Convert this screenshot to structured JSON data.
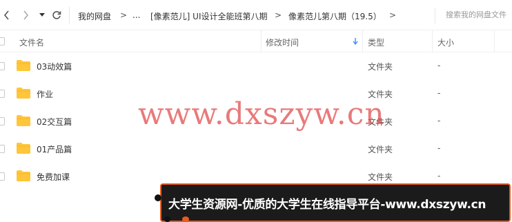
{
  "nav": {
    "back_icon": "chevron-left-icon",
    "forward_icon": "chevron-right-icon",
    "history_icon": "caret-down-icon",
    "refresh_icon": "refresh-icon",
    "breadcrumbs": [
      "我的网盘",
      "...",
      "[像素范儿] UI设计全能班第八期",
      "像素范儿第八期（19.5）"
    ],
    "separator": ">"
  },
  "search": {
    "placeholder": "搜索我的网盘文件"
  },
  "columns": {
    "name": "文件名",
    "modified": "修改时间",
    "type": "类型",
    "size": "大小",
    "sort_icon": "arrow-down-icon"
  },
  "files": [
    {
      "name": "03动效篇",
      "type": "文件夹",
      "size": "-"
    },
    {
      "name": "作业",
      "type": "文件夹",
      "size": "-"
    },
    {
      "name": "02交互篇",
      "type": "文件夹",
      "size": "-"
    },
    {
      "name": "01产品篇",
      "type": "文件夹",
      "size": "-"
    },
    {
      "name": "免费加课",
      "type": "文件夹",
      "size": "-"
    }
  ],
  "watermark": "www.dxszyw.cn",
  "banner": "大学生资源网-优质的大学生在线指导平台-www.dxszyw.cn",
  "colors": {
    "folder": "#FFC63B",
    "watermark": "#E04646",
    "banner_bg": "#1C1B1B",
    "banner_border": "#E85C1F",
    "sort_arrow": "#3B8CFF"
  }
}
